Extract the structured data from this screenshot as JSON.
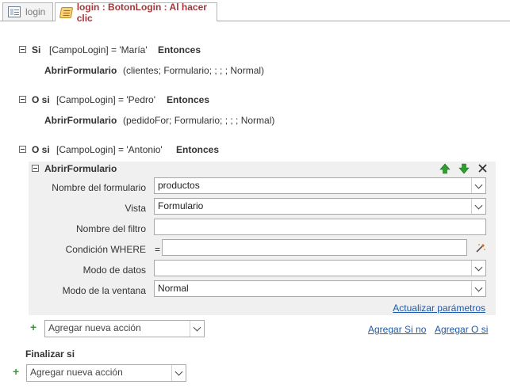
{
  "tabs": [
    {
      "label": "login",
      "icon": "form-icon",
      "active": false
    },
    {
      "label": "login : BotonLogin : Al hacer clic",
      "icon": "macro-icon",
      "active": true
    }
  ],
  "blocks": [
    {
      "keyword": "Si",
      "condition": "[CampoLogin] = 'María'",
      "then": "Entonces",
      "action": "AbrirFormulario",
      "args": "(clientes; Formulario; ; ; ; Normal)"
    },
    {
      "keyword": "O si",
      "condition": "[CampoLogin] = 'Pedro'",
      "then": "Entonces",
      "action": "AbrirFormulario",
      "args": "(pedidoFor; Formulario; ; ; ; Normal)"
    },
    {
      "keyword": "O si",
      "condition": "[CampoLogin] = 'Antonio'",
      "then": "Entonces"
    }
  ],
  "action_block": {
    "title": "AbrirFormulario",
    "fields": {
      "form_name": {
        "label": "Nombre del formulario",
        "value": "productos"
      },
      "view": {
        "label": "Vista",
        "value": "Formulario"
      },
      "filter_name": {
        "label": "Nombre del filtro",
        "value": ""
      },
      "where": {
        "label": "Condición WHERE",
        "prefix": "=",
        "value": ""
      },
      "data_mode": {
        "label": "Modo de datos",
        "value": ""
      },
      "window_mode": {
        "label": "Modo de la ventana",
        "value": "Normal"
      }
    },
    "update_params": "Actualizar parámetros"
  },
  "inner_add": {
    "placeholder": "Agregar nueva acción",
    "add_if": "Agregar Si no",
    "add_or_if": "Agregar O si"
  },
  "end_if": "Finalizar si",
  "outer_add": {
    "placeholder": "Agregar nueva acción"
  },
  "colors": {
    "tab_active_text": "#a4373a",
    "link": "#1e5aa8",
    "plus": "#3a9a3a",
    "arrow_up": "#2f9d2f",
    "arrow_down": "#2f9d2f"
  }
}
